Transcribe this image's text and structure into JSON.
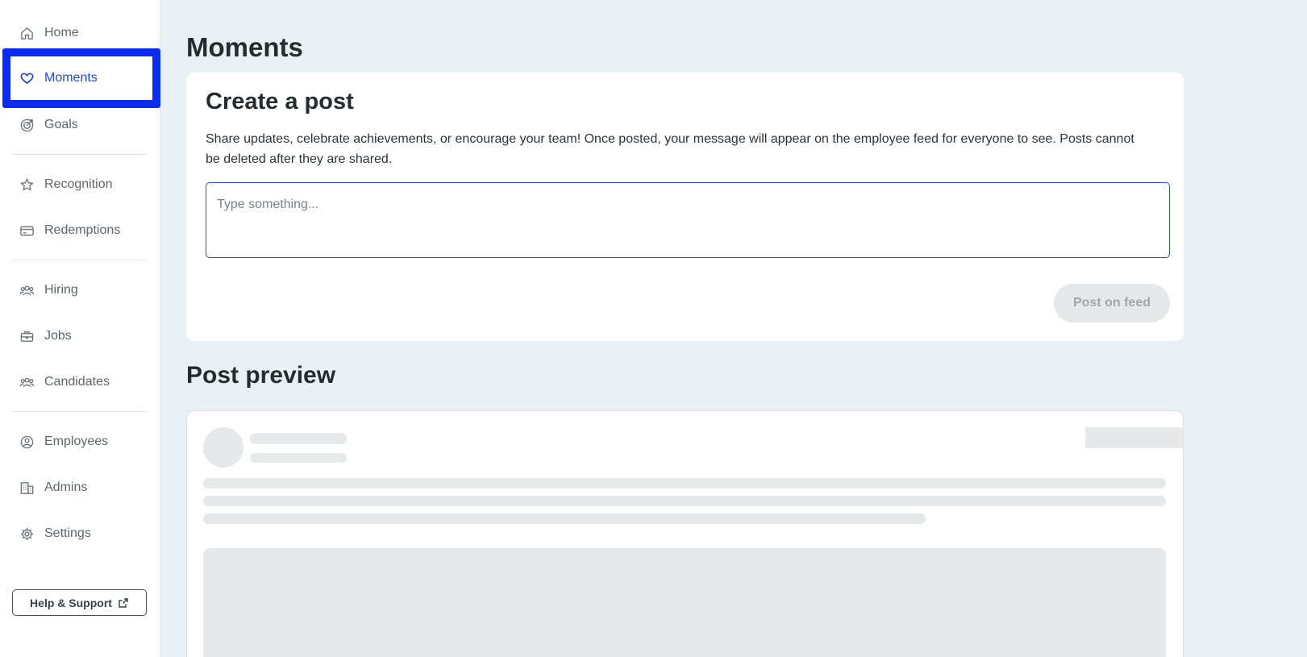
{
  "sidebar": {
    "items": [
      {
        "label": "Home",
        "icon": "home-icon"
      },
      {
        "label": "Moments",
        "icon": "heart-icon",
        "active": true
      },
      {
        "label": "Goals",
        "icon": "target-icon"
      },
      {
        "label": "Recognition",
        "icon": "star-badge-icon"
      },
      {
        "label": "Redemptions",
        "icon": "credit-card-icon"
      },
      {
        "label": "Hiring",
        "icon": "people-icon"
      },
      {
        "label": "Jobs",
        "icon": "briefcase-icon"
      },
      {
        "label": "Candidates",
        "icon": "people-icon"
      },
      {
        "label": "Employees",
        "icon": "user-circle-icon"
      },
      {
        "label": "Admins",
        "icon": "building-icon"
      },
      {
        "label": "Settings",
        "icon": "gear-icon"
      }
    ],
    "help_label": "Help & Support"
  },
  "main": {
    "title": "Moments",
    "create": {
      "title": "Create a post",
      "description": "Share updates, celebrate achievements, or encourage your team! Once posted, your message will appear on the employee feed for everyone to see. Posts cannot be deleted after they are shared.",
      "placeholder": "Type something...",
      "button_label": "Post on feed"
    },
    "preview_title": "Post preview"
  },
  "colors": {
    "accent": "#2147d8",
    "highlight_border": "#0a2cf5",
    "page_bg": "#eaf1f5"
  }
}
